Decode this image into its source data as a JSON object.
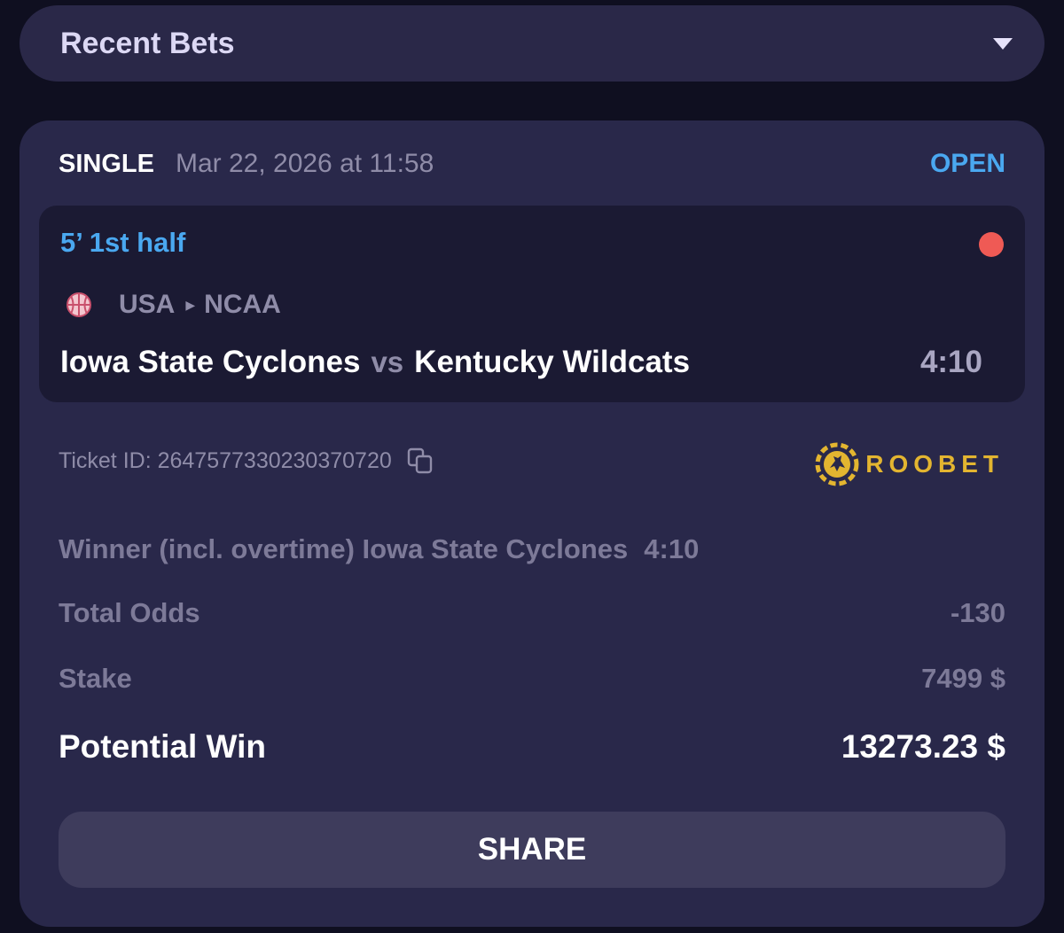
{
  "header": {
    "title": "Recent Bets",
    "toggle_icon": "chevron-down-icon"
  },
  "bet": {
    "type": "SINGLE",
    "date": "Mar 22, 2026 at 11:58",
    "status": "OPEN",
    "event": {
      "live_time": "5’ 1st half",
      "country": "USA",
      "league": "NCAA",
      "sport_icon": "basketball-icon",
      "team_home": "Iowa State Cyclones",
      "vs": "vs",
      "team_away": "Kentucky Wildcats",
      "score": "4:10"
    },
    "ticket_label": "Ticket ID: 2647577330230370720",
    "brand": "ROOBET",
    "selection": {
      "market": "Winner (incl. overtime) Iowa State Cyclones",
      "score": "4:10"
    },
    "total_odds": {
      "label": "Total Odds",
      "value": "-130"
    },
    "stake": {
      "label": "Stake",
      "value": "7499 $"
    },
    "potential_win": {
      "label": "Potential Win",
      "value": "13273.23 $"
    },
    "share_label": "SHARE"
  },
  "colors": {
    "background": "#0f0f20",
    "card": "#29284a",
    "accent_blue": "#4aa8f0",
    "live_red": "#ef5a55",
    "brand_gold": "#e3b530"
  }
}
